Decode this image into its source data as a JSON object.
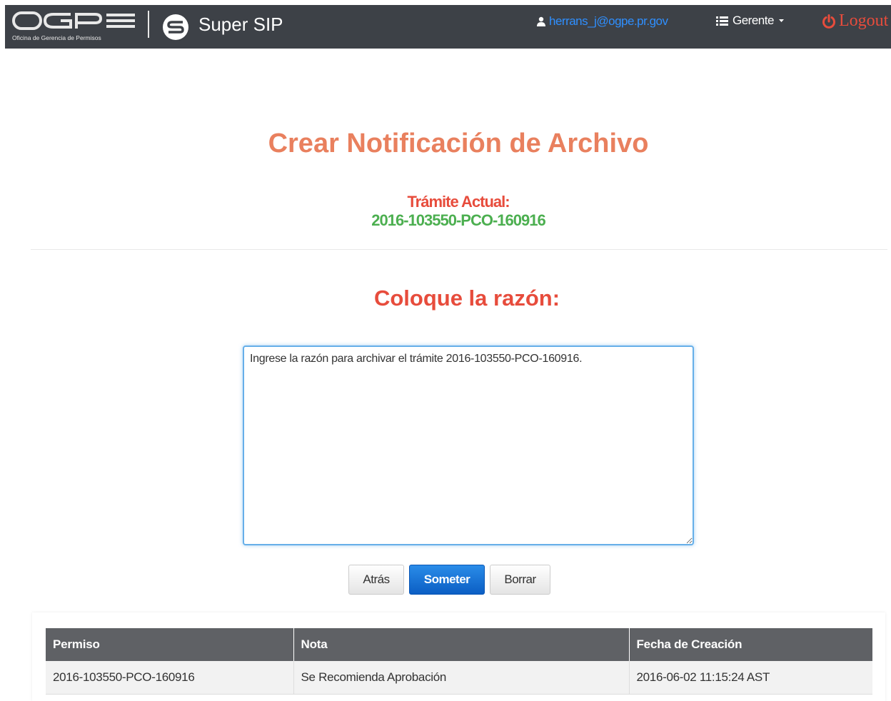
{
  "navbar": {
    "logo_subtitle": "Oficina de Gerencia de Permisos",
    "brand": "Super SIP",
    "user_email": "herrans_j@ogpe.pr.gov",
    "role_menu": "Gerente",
    "logout_label": "Logout",
    "icons": [
      "ogpe-logo",
      "sip-logo-icon",
      "user-icon",
      "list-icon",
      "caret-down-icon",
      "power-icon"
    ]
  },
  "page": {
    "title": "Crear Notificación de Archivo",
    "tramite_label": "Trámite Actual:",
    "tramite_value": "2016-103550-PCO-160916",
    "reason_heading": "Coloque la razón:"
  },
  "form": {
    "reason_value": "Ingrese la razón para archivar el trámite 2016-103550-PCO-160916."
  },
  "buttons": {
    "back_label": "Atrás",
    "submit_label": "Someter",
    "clear_label": "Borrar"
  },
  "colors": {
    "navbar": "#3d4147",
    "title": "#e9805e",
    "accent_red": "#e74c3c",
    "tramite_green": "#4caf50",
    "link_blue": "#2f8fff",
    "primary_button": "#0b5ec4"
  },
  "table": {
    "headers": [
      "Permiso",
      "Nota",
      "Fecha de Creación"
    ],
    "rows": [
      [
        "2016-103550-PCO-160916",
        "Se Recomienda Aprobación",
        "2016-06-02 11:15:24 AST"
      ]
    ]
  }
}
